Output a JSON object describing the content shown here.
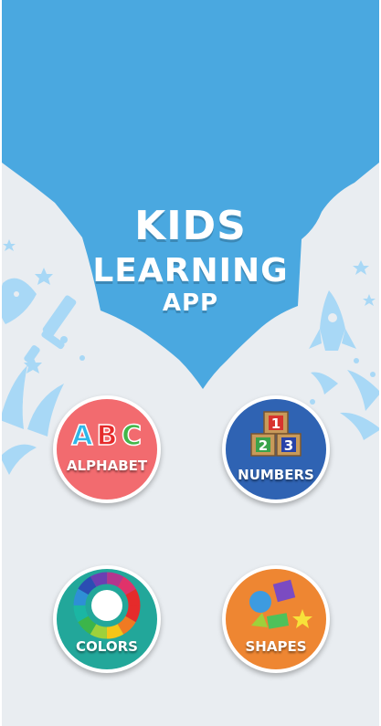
{
  "title": {
    "line1": "KIDS",
    "line2": "LEARNING",
    "line3": "APP"
  },
  "menu": {
    "alphabet": {
      "label": "ALPHABET",
      "art": [
        "A",
        "B",
        "C"
      ]
    },
    "numbers": {
      "label": "NUMBERS",
      "art": [
        "1",
        "2",
        "3"
      ]
    },
    "colors": {
      "label": "COLORS"
    },
    "shapes": {
      "label": "SHAPES"
    }
  },
  "icons": [
    "fish-icon",
    "sword-icon",
    "star-icon",
    "rocket-icon",
    "color-wheel-icon",
    "number-blocks-icon",
    "shapes-icon"
  ],
  "colors": {
    "sky": "#4aa8e0",
    "alphabet": "#f26b6f",
    "numbers": "#2f63b3",
    "colors": "#22a79a",
    "shapes": "#ee8632"
  }
}
